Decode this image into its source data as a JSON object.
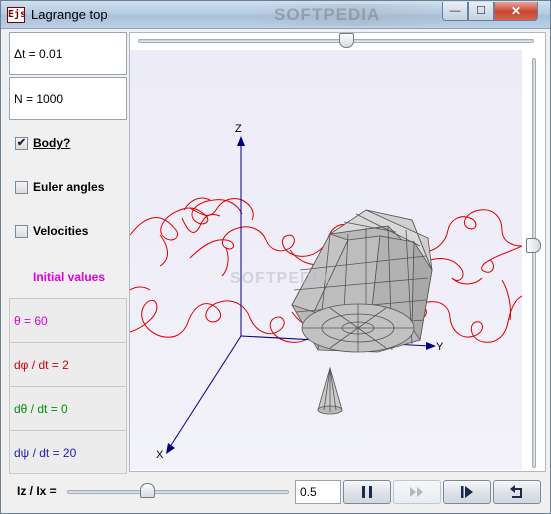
{
  "window": {
    "title": "Lagrange top",
    "icon_text": "Ejs",
    "title_watermark": "SOFTPEDIA",
    "controls": {
      "minimize": "—",
      "maximize": "☐",
      "close": "✕"
    }
  },
  "left_panel": {
    "dt_field": "Δt = 0.01",
    "n_field": "N = 1000",
    "checkboxes": [
      {
        "label": "Body?",
        "checked": true,
        "checkmark": "✔"
      },
      {
        "label": "Euler angles",
        "checked": false
      },
      {
        "label": "Velocities",
        "checked": false
      }
    ],
    "initial_values_title": "Initial values",
    "params": [
      {
        "label": "θ = 60",
        "color": "#e000e0"
      },
      {
        "label": "dφ / dt = 2",
        "color": "#d00000"
      },
      {
        "label": "dθ / dt = 0",
        "color": "#009000"
      },
      {
        "label": "dψ / dt = 20",
        "color": "#2020b0"
      }
    ]
  },
  "plot": {
    "axes": {
      "x": "X",
      "y": "Y",
      "z": "Z"
    },
    "watermark": "SOFTPEDIA",
    "trajectory_color": "#e00000",
    "axis_color": "#000080",
    "body_color": "#c8c8c8"
  },
  "bottom_bar": {
    "ratio_label": "Iz / Ix =",
    "ratio_value": "0.5",
    "ratio_slider_fraction": 0.38,
    "buttons": [
      {
        "name": "pause",
        "icon": "pause-icon",
        "enabled": true
      },
      {
        "name": "step",
        "icon": "step-icon",
        "enabled": false
      },
      {
        "name": "play-step",
        "icon": "play-step-icon",
        "enabled": true
      },
      {
        "name": "reset",
        "icon": "reset-icon",
        "enabled": true
      }
    ]
  }
}
